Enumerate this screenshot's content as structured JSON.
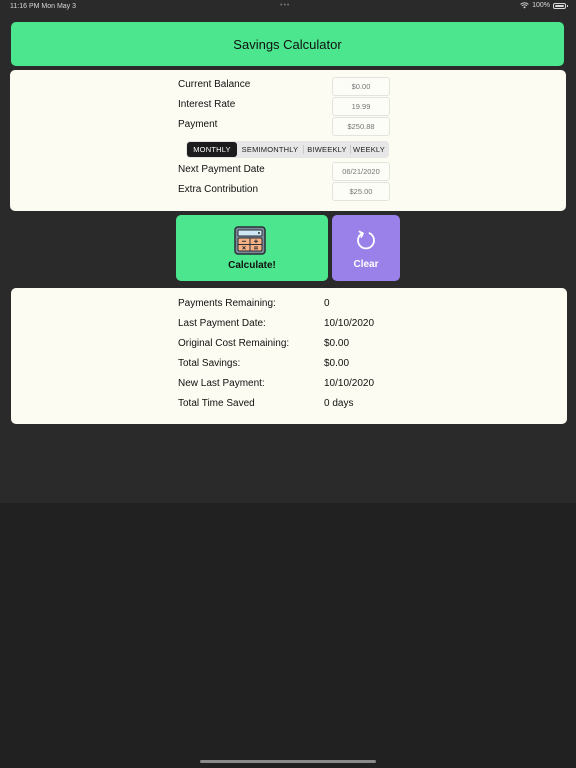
{
  "status_bar": {
    "time": "11:16 PM   Mon May 3",
    "dots": "•••",
    "battery": "100%"
  },
  "header": {
    "title": "Savings Calculator"
  },
  "inputs": {
    "current_balance": {
      "label": "Current Balance",
      "placeholder": "$0.00"
    },
    "interest_rate": {
      "label": "Interest Rate",
      "placeholder": "19.99"
    },
    "payment": {
      "label": "Payment",
      "placeholder": "$250.88"
    },
    "frequency": {
      "options": [
        "MONTHLY",
        "SEMIMONTHLY",
        "BIWEEKLY",
        "WEEKLY"
      ],
      "selected": "MONTHLY"
    },
    "next_payment_date": {
      "label": "Next Payment Date",
      "placeholder": "06/21/2020"
    },
    "extra_contribution": {
      "label": "Extra Contribution",
      "placeholder": "$25.00"
    }
  },
  "actions": {
    "calculate_label": "Calculate!",
    "clear_label": "Clear"
  },
  "results": [
    {
      "label": "Payments Remaining:",
      "value": "0"
    },
    {
      "label": "Last Payment Date:",
      "value": "10/10/2020"
    },
    {
      "label": "Original Cost Remaining:",
      "value": "$0.00"
    },
    {
      "label": "Total Savings:",
      "value": "$0.00"
    },
    {
      "label": "New Last Payment:",
      "value": "10/10/2020"
    },
    {
      "label": "Total Time Saved",
      "value": "0 days"
    }
  ],
  "colors": {
    "accent_green": "#4ce68e",
    "accent_purple": "#9a81ea",
    "card_background": "#fcfcf3",
    "page_background": "#2a2a2a"
  }
}
